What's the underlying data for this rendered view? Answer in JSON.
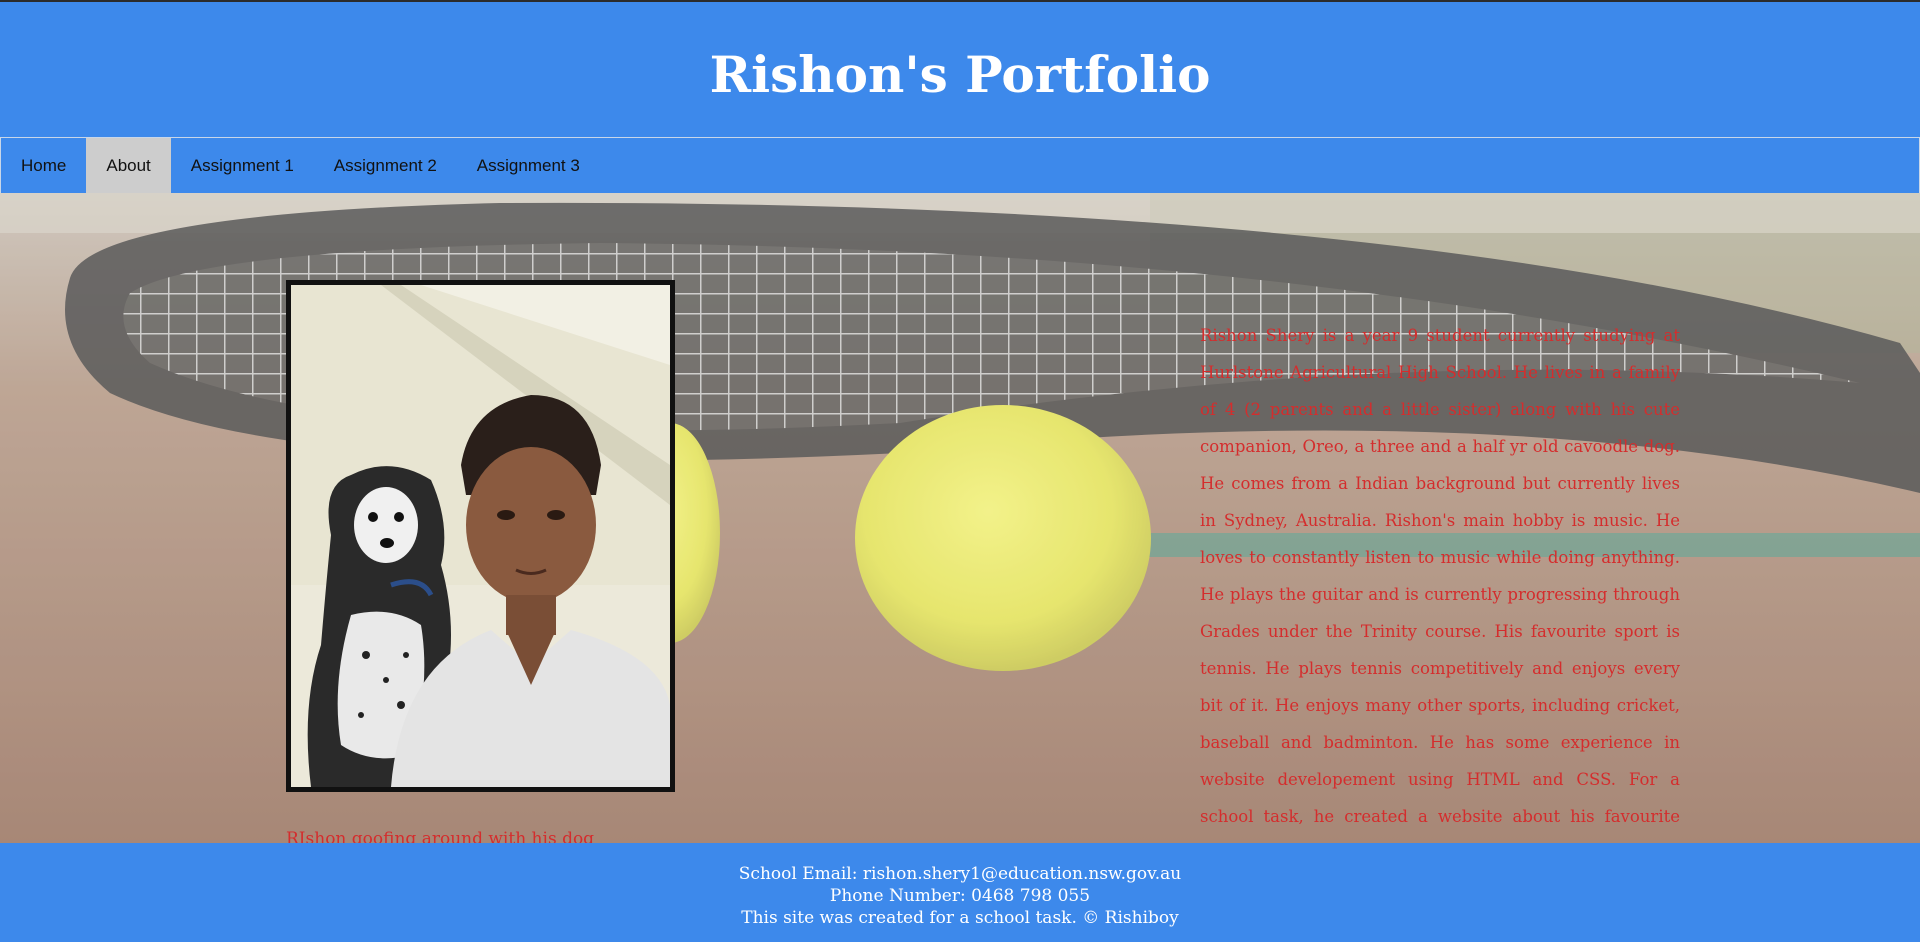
{
  "site": {
    "title": "Rishon's Portfolio"
  },
  "nav": {
    "items": [
      {
        "label": "Home",
        "active": false
      },
      {
        "label": "About",
        "active": true
      },
      {
        "label": "Assignment 1",
        "active": false
      },
      {
        "label": "Assignment 2",
        "active": false
      },
      {
        "label": "Assignment 3",
        "active": false
      }
    ]
  },
  "about": {
    "photo_description_icon": "photo-of-boy-with-dog",
    "caption": "RIshon goofing around with his dog",
    "bio": "Rishon Shery is a year 9 student currently studying at Hurlstone Agricultural High School. He lives in a family of 4 (2 parents and a little sister) along with his cute companion, Oreo, a three and a half yr old cavoodle dog. He comes from a Indian background but currently lives in Sydney, Australia. Rishon's main hobby is music. He loves to constantly listen to music while doing anything. He plays the guitar and is currently progressing through Grades under the Trinity course. His favourite sport is tennis. He plays tennis competitively and enjoys every bit of it. He enjoys many other sports, including cricket, baseball and badminton. He has some experience in website developement using HTML and CSS. For a school task, he created a website about his favourite superhero. The link to the website:"
  },
  "footer": {
    "email": "School Email: rishon.shery1@education.nsw.gov.au",
    "phone": "Phone Number: 0468 798 055",
    "credit": "This site was created for a school task. © Rishiboy"
  },
  "colors": {
    "brand_blue": "#3d89eb",
    "active_tab": "#cdcdcd",
    "text_red": "#d42d2d"
  }
}
